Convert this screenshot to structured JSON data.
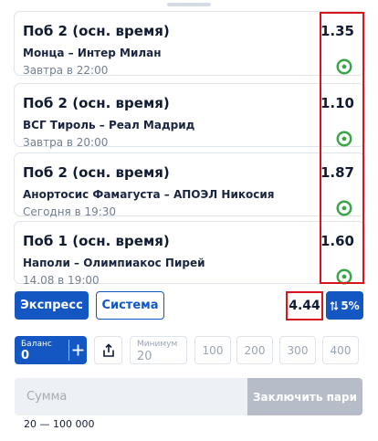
{
  "bets": [
    {
      "title": "Поб 2 (осн. время)",
      "match": "Монца – Интер Милан",
      "time": "Завтра в 22:00",
      "odd": "1.35"
    },
    {
      "title": "Поб 2 (осн. время)",
      "match": "ВСГ Тироль – Реал Мадрид",
      "time": "Завтра в 20:00",
      "odd": "1.10"
    },
    {
      "title": "Поб 2 (осн. время)",
      "match": "Анортосис Фамагуста – АПОЭЛ Никосия",
      "time": "Сегодня в 19:30",
      "odd": "1.87"
    },
    {
      "title": "Поб 1 (осн. время)",
      "match": "Наполи – Олимпиакос Пирей",
      "time": "14.08 в 19:00",
      "odd": "1.60"
    }
  ],
  "bet_type": {
    "express": "Экспресс",
    "system": "Система"
  },
  "total_odd": "4.44",
  "boost": {
    "icon": "sort-arrows-icon",
    "value": "5%"
  },
  "balance": {
    "label": "Баланс",
    "value": "0"
  },
  "minimum": {
    "label": "Минимум",
    "value": "20"
  },
  "quick_amounts": [
    "100",
    "200",
    "300",
    "400"
  ],
  "sum_input": {
    "placeholder": "Сумма",
    "value": ""
  },
  "place_bet_label": "Заключить пари",
  "range_hint": "20 — 100 000",
  "colors": {
    "accent": "#1457c3",
    "highlight_frame": "#d8141c",
    "sport_icon": "#3aa546",
    "disabled_button": "#b7bdc8"
  }
}
